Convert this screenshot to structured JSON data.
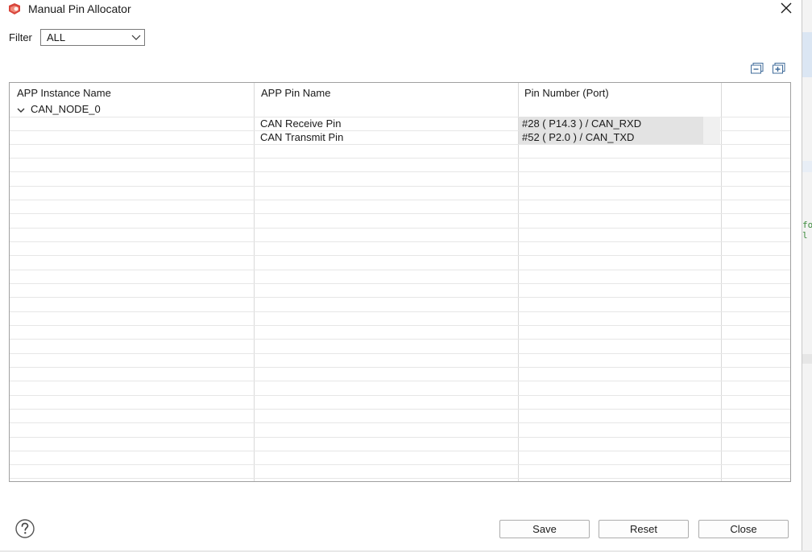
{
  "window": {
    "title": "Manual Pin Allocator"
  },
  "filter": {
    "label": "Filter",
    "selected": "ALL"
  },
  "toolbar": {
    "collapse_all_icon": "collapse-all-icon",
    "expand_all_icon": "expand-all-icon"
  },
  "table": {
    "columns": [
      "APP Instance Name",
      "APP Pin Name",
      "Pin Number (Port)"
    ],
    "group": {
      "name": "CAN_NODE_0",
      "expanded": true
    },
    "rows": [
      {
        "pin_name": "CAN Receive Pin",
        "pin_number": "#28 ( P14.3 ) /  CAN_RXD"
      },
      {
        "pin_name": "CAN Transmit Pin",
        "pin_number": "#52 ( P2.0 ) /  CAN_TXD"
      }
    ]
  },
  "footer": {
    "help_icon": "help-icon",
    "save_label": "Save",
    "reset_label": "Reset",
    "close_label": "Close"
  },
  "background": {
    "code_lines": [
      "fo",
      "l"
    ]
  },
  "colors": {
    "accent_icon": "#d8453b",
    "selected_cell": "#e3e3e3",
    "grid_line": "#e6e6e6"
  }
}
